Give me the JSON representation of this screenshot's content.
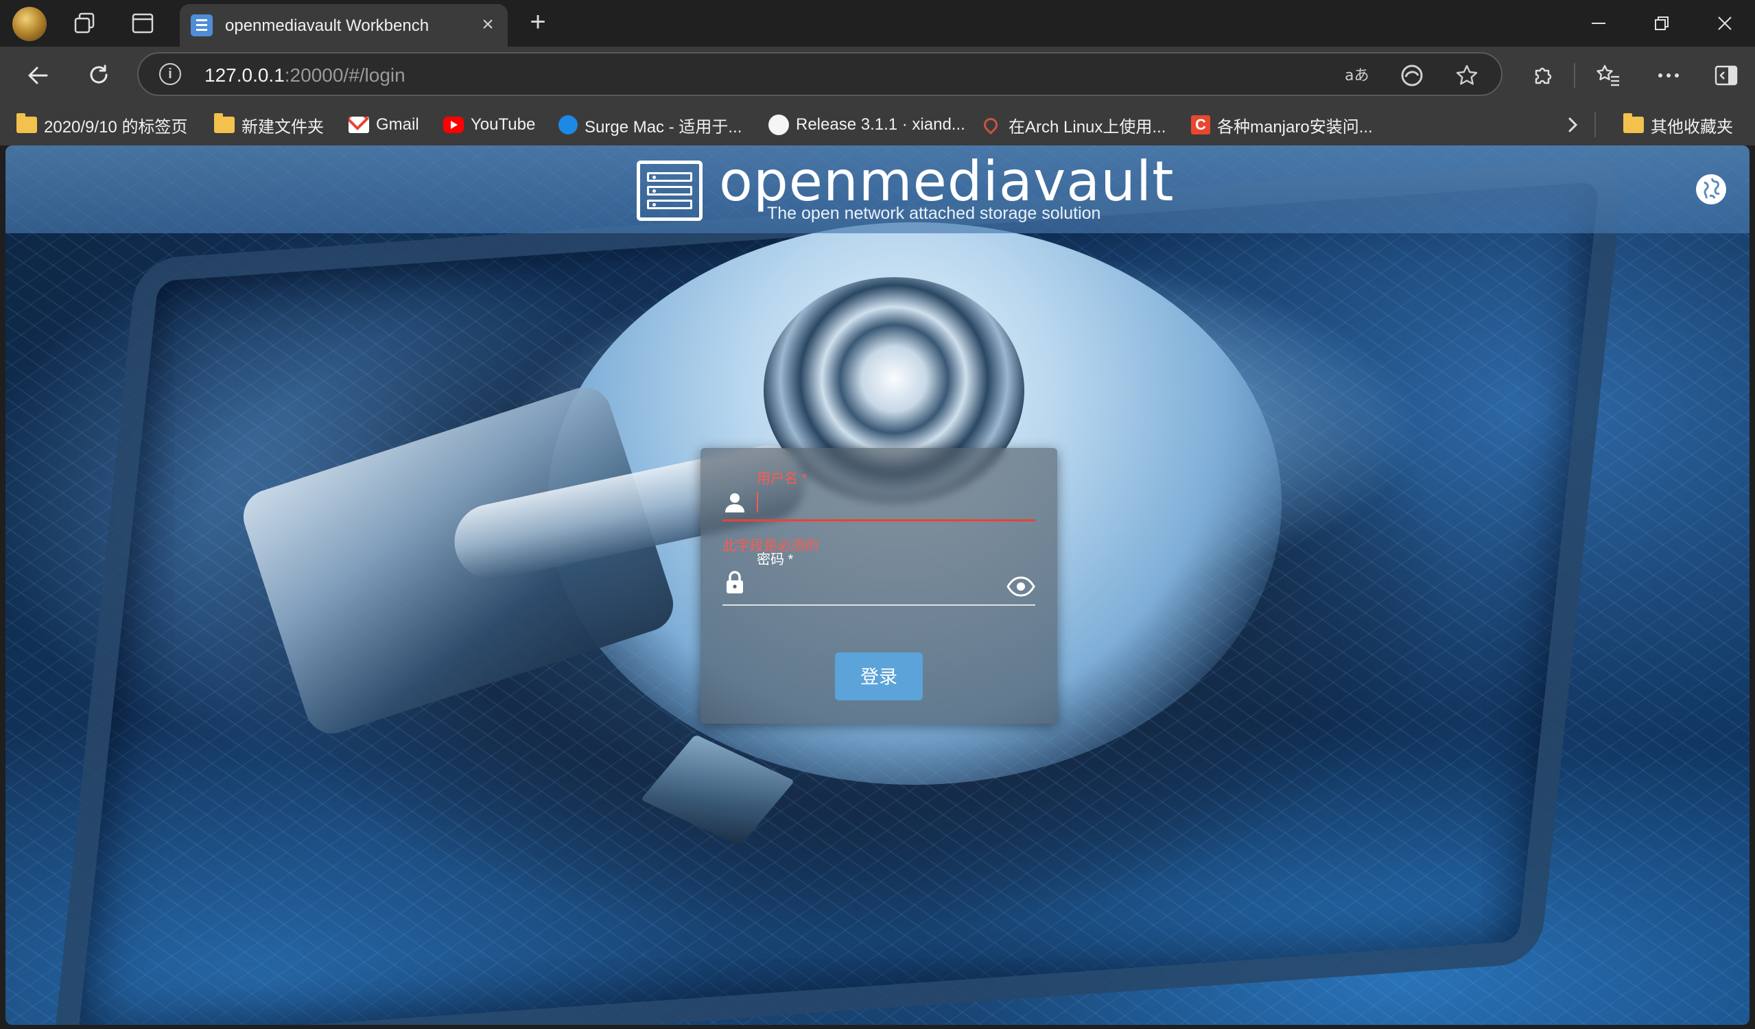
{
  "browser": {
    "tab_title": "openmediavault Workbench",
    "url_host": "127.0.0.1",
    "url_rest": ":20000/#/login"
  },
  "bookmarks": [
    {
      "label": "2020/9/10 的标签页",
      "icon": "folder-icon"
    },
    {
      "label": "新建文件夹",
      "icon": "folder-icon"
    },
    {
      "label": "Gmail",
      "icon": "gmail-icon"
    },
    {
      "label": "YouTube",
      "icon": "youtube-icon"
    },
    {
      "label": "Surge Mac - 适用于...",
      "icon": "surge-icon"
    },
    {
      "label": "Release 3.1.1 · xiand...",
      "icon": "github-icon"
    },
    {
      "label": "在Arch Linux上使用...",
      "icon": "arch-icon"
    },
    {
      "label": "各种manjaro安装问...",
      "icon": "c-icon"
    }
  ],
  "bookmarks_other": "其他收藏夹",
  "omv": {
    "brand": "openmediavault",
    "tagline": "The open network attached storage solution"
  },
  "login": {
    "username_label": "用户名 *",
    "username_error": "此字段是必须的",
    "password_label": "密码 *",
    "submit_label": "登录"
  },
  "colors": {
    "error": "#e94335",
    "button": "#5ba3d9",
    "header": "#5a8cbe"
  }
}
